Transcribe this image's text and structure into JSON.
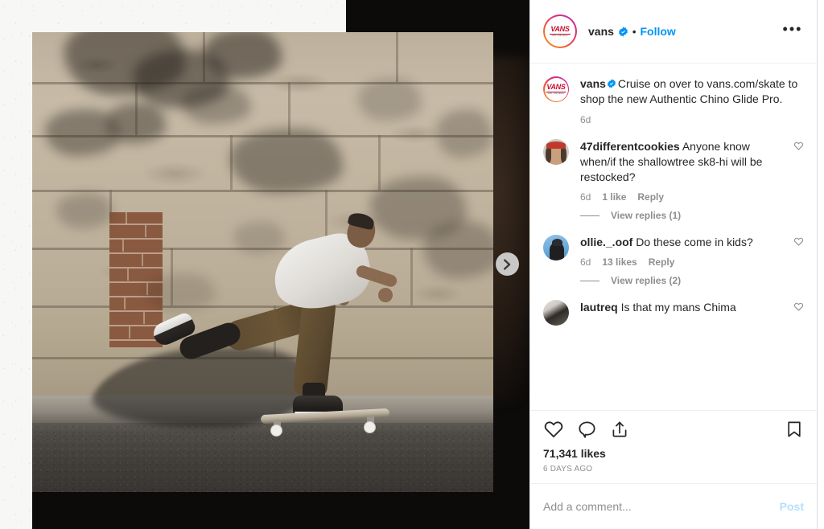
{
  "post": {
    "header": {
      "username": "vans",
      "verified_icon": "verified-badge-icon",
      "separator": "•",
      "follow_label": "Follow",
      "more_options": "•••",
      "avatar_logo_word": "VANS",
      "avatar_logo_tag": "\"OFF THE WALL\""
    },
    "caption": {
      "username": "vans",
      "text": "Cruise on over to vans.com/skate to shop the new Authentic Chino Glide Pro.",
      "time": "6d"
    },
    "comments": [
      {
        "username": "47differentcookies",
        "text": "Anyone know when/if the shallowtree sk8-hi will be restocked?",
        "time": "6d",
        "likes": "1 like",
        "reply_label": "Reply",
        "view_replies": "View replies (1)",
        "avatar": "bandana-face-avatar"
      },
      {
        "username": "ollie._.oof",
        "text": "Do these come in kids?",
        "time": "6d",
        "likes": "13 likes",
        "reply_label": "Reply",
        "view_replies": "View replies (2)",
        "avatar": "blue-background-avatar"
      },
      {
        "username": "lautreq",
        "text": "Is that my mans Chima",
        "time": "",
        "likes": "",
        "reply_label": "",
        "view_replies": "",
        "avatar": "dark-grey-avatar"
      }
    ],
    "actions": {
      "like_icon": "heart-icon",
      "comment_icon": "speech-bubble-icon",
      "share_icon": "share-arrow-icon",
      "save_icon": "bookmark-icon",
      "likes_count": "71,341 likes",
      "posted_ago": "6 DAYS AGO"
    },
    "add_comment": {
      "placeholder": "Add a comment...",
      "value": "",
      "post_label": "Post"
    }
  },
  "media": {
    "carousel_next_icon": "chevron-right-icon",
    "alt": "Skateboarder pushing along pavement in front of a weathered sandstone wall"
  },
  "colors": {
    "accent_blue": "#0095f6",
    "post_btn_blue": "#b2dffc",
    "text_primary": "#262626",
    "text_muted": "#8e8e8e",
    "border": "#efefef",
    "vans_red": "#c8102e"
  }
}
